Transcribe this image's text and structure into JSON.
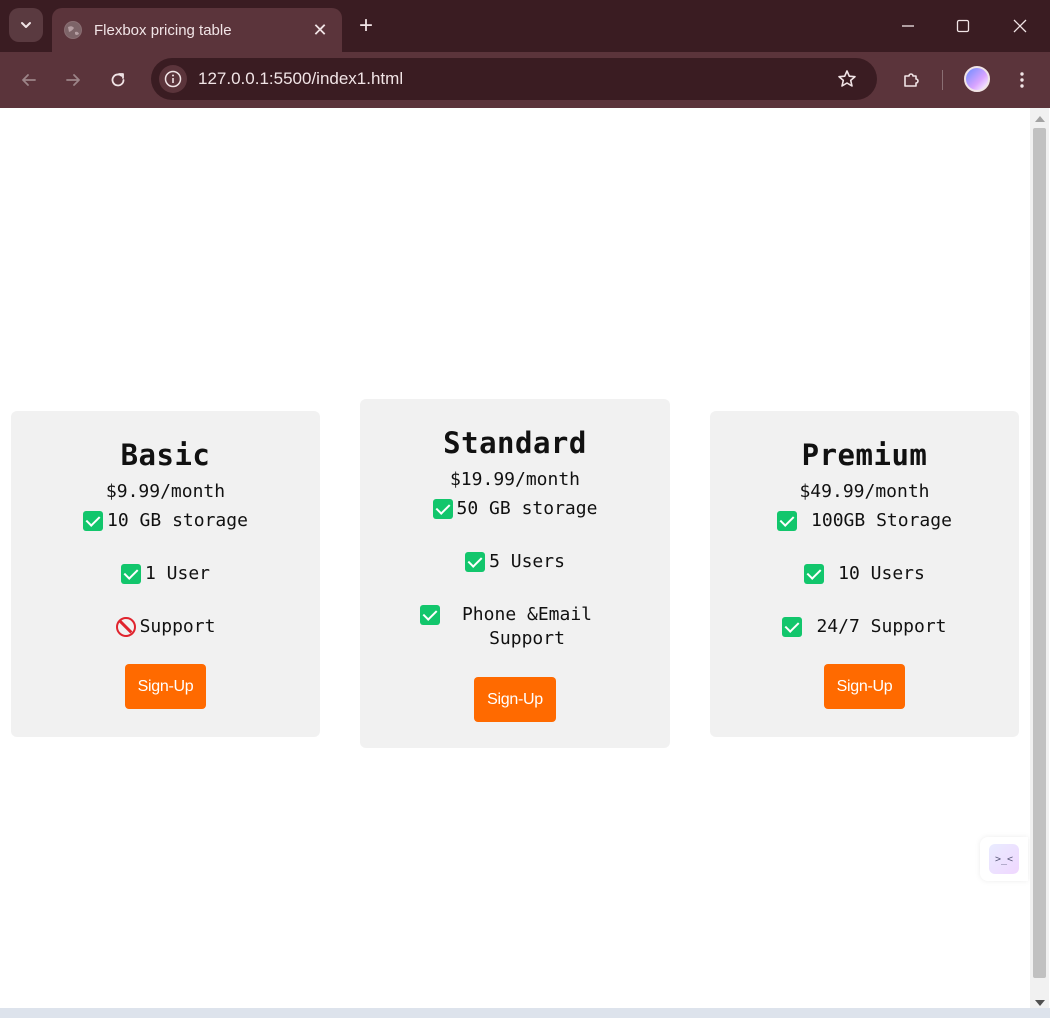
{
  "browser": {
    "tab_title": "Flexbox pricing table",
    "url": "127.0.0.1:5500/index1.html",
    "new_tab_label": "+",
    "close_tab_label": "✕"
  },
  "plans": [
    {
      "name": "Basic",
      "price": "$9.99/month",
      "features": [
        {
          "icon": "check-icon",
          "text": "10 GB storage"
        },
        {
          "icon": "check-icon",
          "text": "1 User"
        },
        {
          "icon": "no-icon",
          "text": "Support"
        }
      ],
      "button": "Sign-Up"
    },
    {
      "name": "Standard",
      "price": "$19.99/month",
      "features": [
        {
          "icon": "check-icon",
          "text": "50 GB storage"
        },
        {
          "icon": "check-icon",
          "text": "5 Users"
        },
        {
          "icon": "check-icon",
          "text": "Phone &Email Support"
        }
      ],
      "button": "Sign-Up"
    },
    {
      "name": "Premium",
      "price": "$49.99/month",
      "features": [
        {
          "icon": "check-icon",
          "text": "100GB Storage"
        },
        {
          "icon": "check-icon",
          "text": "10 Users"
        },
        {
          "icon": "check-icon",
          "text": "24/7 Support"
        }
      ],
      "button": "Sign-Up"
    }
  ],
  "widget": {
    "label": ">_<"
  },
  "colors": {
    "button": "#ff6a00",
    "check": "#12c66c",
    "no": "#e0242e",
    "card_bg": "#f1f1f1",
    "chrome_dark": "#3a1c22",
    "chrome_mid": "#5b343b"
  }
}
